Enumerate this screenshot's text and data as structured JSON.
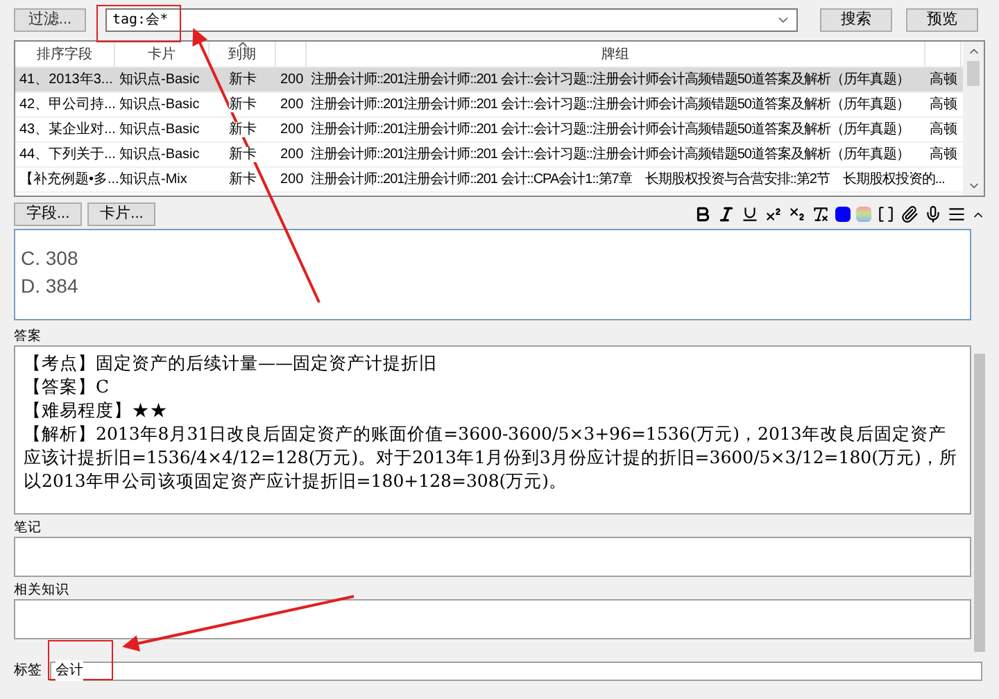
{
  "toolbar": {
    "filter_button": "过滤...",
    "search": {
      "value": "tag:会*"
    },
    "search_button": "搜索",
    "preview_button": "预览"
  },
  "table": {
    "columns": [
      {
        "label": "排序字段",
        "sorted": false
      },
      {
        "label": "卡片",
        "sorted": false
      },
      {
        "label": "到期",
        "sorted": true
      },
      {
        "sorted": false
      },
      {
        "label": "牌组",
        "sorted": false
      },
      {
        "sorted": false
      }
    ],
    "rows": [
      {
        "sort_field": "41、2013年3...",
        "card": "知识点-Basic",
        "due": "新卡",
        "column_4": "200",
        "deck": "注册会计师::201注册会计师::201 会计::会计习题::注册会计师会计高频错题50道答案及解析（历年真题）",
        "column_6": "高顿",
        "selected": true
      },
      {
        "sort_field": "42、甲公司持...",
        "card": "知识点-Basic",
        "due": "新卡",
        "column_4": "200",
        "deck": "注册会计师::201注册会计师::201 会计::会计习题::注册会计师会计高频错题50道答案及解析（历年真题）",
        "column_6": "高顿",
        "selected": false
      },
      {
        "sort_field": "43、某企业对...",
        "card": "知识点-Basic",
        "due": "新卡",
        "column_4": "200",
        "deck": "注册会计师::201注册会计师::201 会计::会计习题::注册会计师会计高频错题50道答案及解析（历年真题）",
        "column_6": "高顿",
        "selected": false
      },
      {
        "sort_field": "44、下列关于...",
        "card": "知识点-Basic",
        "due": "新卡",
        "column_4": "200",
        "deck": "注册会计师::201注册会计师::201 会计::会计习题::注册会计师会计高频错题50道答案及解析（历年真题）",
        "column_6": "高顿",
        "selected": false
      },
      {
        "sort_field": "【补充例题•多...",
        "card": "知识点-Mix",
        "due": "新卡",
        "column_4": "200",
        "deck": "注册会计师::201注册会计师::201 会计::CPA会计1::第7章　长期股权投资与合营安排::第2节　长期股权投资的...",
        "selected": false
      }
    ]
  },
  "editor": {
    "fields_button": "字段...",
    "cards_button": "卡片...",
    "question": {
      "lines": [
        "C. 308",
        "D. 384"
      ]
    },
    "answer": {
      "label": "答案",
      "lines": [
        "【考点】固定资产的后续计量——固定资产计提折旧",
        "【答案】C",
        "【难易程度】★★",
        "【解析】2013年8月31日改良后固定资产的账面价值=3600-3600/5×3+96=1536(万元)，2013年改良后固定资产应该计提折旧=1536/4×4/12=128(万元)。对于2013年1月份到3月份应计提的折旧=3600/5×3/12=180(万元)，所以2013年甲公司该项固定资产应计提折旧=180+128=308(万元)。"
      ]
    },
    "extra_fields": [
      {
        "label": "笔记"
      },
      {
        "label": "相关知识"
      }
    ],
    "tags": {
      "label": "标签",
      "value": "会计"
    }
  }
}
